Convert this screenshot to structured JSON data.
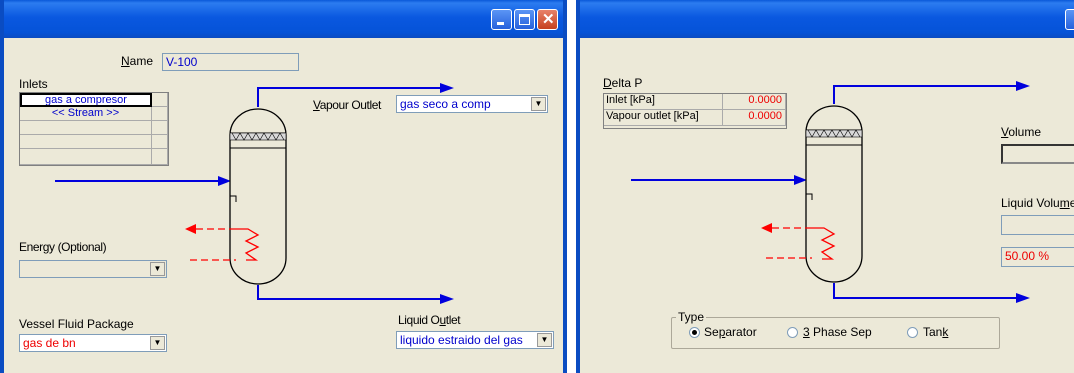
{
  "window1": {
    "name_label": "Name",
    "name_value": "V-100",
    "inlets_label": "Inlets",
    "inlet_streams": [
      "gas a compresor",
      "<< Stream >>"
    ],
    "vapour_outlet_label": "Vapour Outlet",
    "vapour_outlet_value": "gas seco a comp",
    "energy_label": "Energy (Optional)",
    "energy_value": "",
    "fluid_package_label": "Vessel Fluid Package",
    "fluid_package_value": "gas de bn",
    "liquid_outlet_label": "Liquid Outlet",
    "liquid_outlet_value": "liquido estraido del gas"
  },
  "window2": {
    "delta_p_label": "Delta P",
    "delta_p_rows": [
      {
        "label": "Inlet [kPa]",
        "value": "0.0000"
      },
      {
        "label": "Vapour outlet [kPa]",
        "value": "0.0000"
      }
    ],
    "volume_label": "Volume",
    "volume_value": "",
    "liquid_volume_label": "Liquid Volume",
    "liquid_volume_value": "",
    "liquid_level_value": "50.00 %",
    "type_label": "Type",
    "type_options": [
      "Separator",
      "3 Phase Sep",
      "Tank"
    ],
    "type_selected": "Separator"
  },
  "colors": {
    "stream": "#0000dd",
    "energy": "#ff0000",
    "titlebar": "#0a58e0",
    "face": "#ece9d8"
  }
}
